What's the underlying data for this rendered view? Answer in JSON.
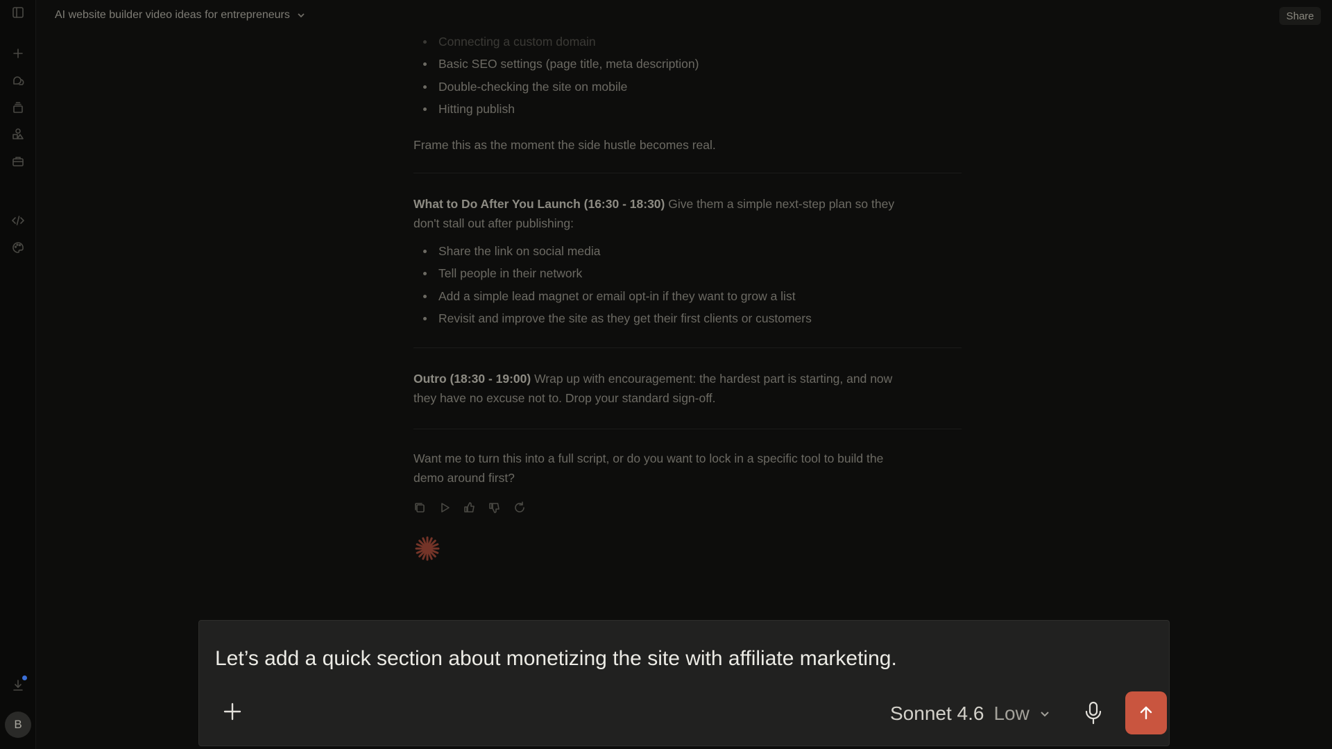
{
  "header": {
    "chat_title": "AI website builder video ideas for entrepreneurs",
    "share_label": "Share"
  },
  "sidebar": {
    "avatar_initial": "B",
    "icons": [
      "sidebar-toggle-icon",
      "new-chat-icon",
      "chats-icon",
      "projects-icon",
      "artifacts-icon",
      "toolbox-icon",
      "code-icon",
      "palette-icon",
      "download-icon"
    ]
  },
  "transcript": {
    "list_1": [
      "Connecting a custom domain",
      "Basic SEO settings (page title, meta description)",
      "Double-checking the site on mobile",
      "Hitting publish"
    ],
    "frame_note": "Frame this as the moment the side hustle becomes real.",
    "section_2": {
      "heading": "What to Do After You Launch (16:30 - 18:30)",
      "body_line_1": " Give them a simple next-step plan so they",
      "body_line_2": "don't stall out after publishing:",
      "items": [
        "Share the link on social media",
        "Tell people in their network",
        "Add a simple lead magnet or email opt-in if they want to grow a list",
        "Revisit and improve the site as they get their first clients or customers"
      ]
    },
    "section_3": {
      "heading": "Outro (18:30 - 19:00)",
      "body_line_1": " Wrap up with encouragement: the hardest part is starting, and now",
      "body_line_2": "they have no excuse not to. Drop your standard sign-off."
    },
    "closing_line_1": "Want me to turn this into a full script, or do you want to lock in a specific tool to build the",
    "closing_line_2": "demo around first?"
  },
  "composer": {
    "input_text": "Let’s add a quick section about monetizing the site with affiliate marketing.",
    "model_name": "Sonnet 4.6",
    "effort_level": "Low"
  },
  "colors": {
    "accent": "#c9553f",
    "background": "#0d0d0c",
    "composer_bg": "#212120",
    "notification": "#3b6fd6"
  }
}
